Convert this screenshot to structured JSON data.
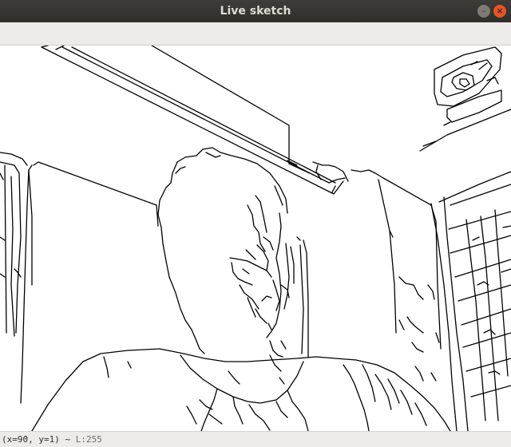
{
  "window": {
    "title": "Live sketch",
    "minimize_icon": "minimize-icon",
    "close_icon": "close-icon",
    "minimize_glyph": "–",
    "close_glyph": "×"
  },
  "image": {
    "description_icon": "edge-sketch-image"
  },
  "status": {
    "coords": "(x=90, y=1) ~",
    "value": "L:255"
  },
  "colors": {
    "titlebar": "#2f2e2b",
    "close_button": "#e95420",
    "sketch_line": "#000000",
    "canvas": "#ffffff"
  }
}
